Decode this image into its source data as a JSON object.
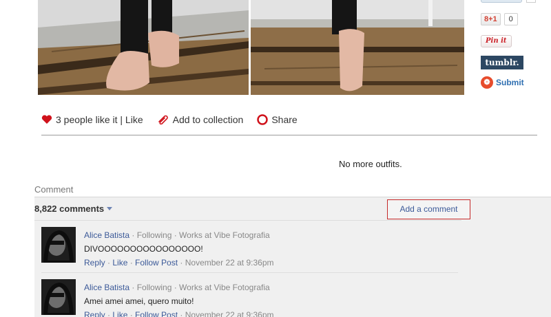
{
  "share": {
    "gplus_label": "8+1",
    "gplus_count": "0",
    "pin_label": "Pin it",
    "tumblr_label": "tumblr.",
    "submit_label": "Submit"
  },
  "actions": {
    "like_text": "3 people like it | Like",
    "collection_text": "Add to collection",
    "share_text": "Share"
  },
  "status": {
    "no_more": "No more outfits."
  },
  "comments": {
    "heading": "Comment",
    "count_label": "8,822 comments",
    "add_button": "Add a comment",
    "items": [
      {
        "author": "Alice Batista",
        "meta": "· Following · Works at Vibe Fotografia",
        "text": "DIVOOOOOOOOOOOOOOOO!",
        "reply": "Reply",
        "like": "Like",
        "follow": "Follow Post",
        "date": "November 22 at 9:36pm"
      },
      {
        "author": "Alice Batista",
        "meta": "· Following · Works at Vibe Fotografia",
        "text": "Amei amei amei, quero muito!",
        "reply": "Reply",
        "like": "Like",
        "follow": "Follow Post",
        "date": "November 22 at 9:36pm"
      }
    ]
  },
  "colors": {
    "link": "#3b5998",
    "accent_red": "#c52828",
    "tumblr": "#2c4762"
  }
}
